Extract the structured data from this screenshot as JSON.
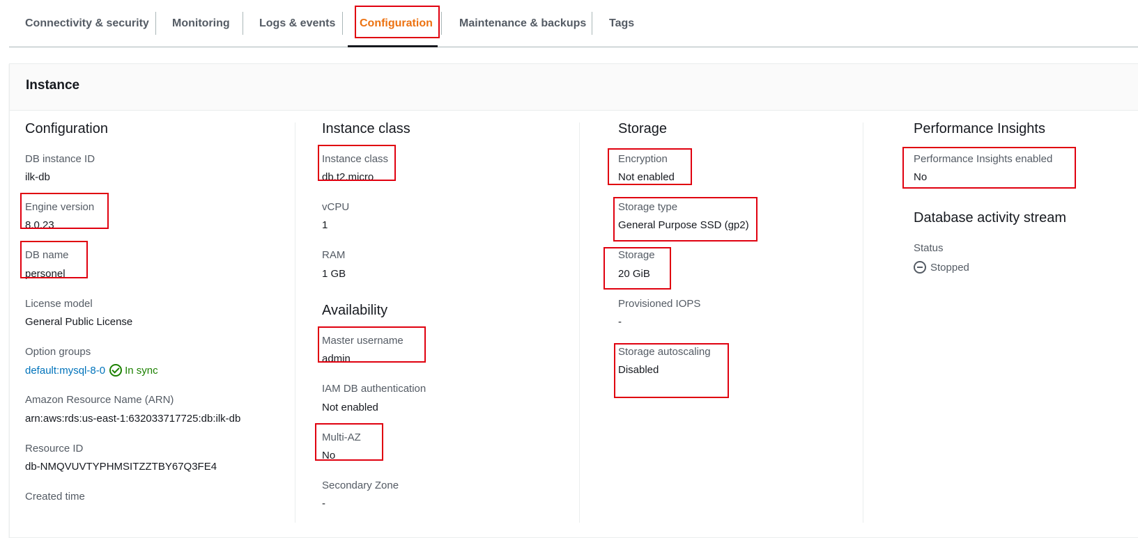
{
  "tabs": [
    {
      "label": "Connectivity & security"
    },
    {
      "label": "Monitoring"
    },
    {
      "label": "Logs & events"
    },
    {
      "label": "Configuration",
      "active": true
    },
    {
      "label": "Maintenance & backups"
    },
    {
      "label": "Tags"
    }
  ],
  "card": {
    "title": "Instance"
  },
  "configuration": {
    "title": "Configuration",
    "db_instance_id_label": "DB instance ID",
    "db_instance_id": "ilk-db",
    "engine_version_label": "Engine version",
    "engine_version": "8.0.23",
    "db_name_label": "DB name",
    "db_name": "personel",
    "license_model_label": "License model",
    "license_model": "General Public License",
    "option_groups_label": "Option groups",
    "option_group": "default:mysql-8-0",
    "option_group_status": "In sync",
    "arn_label": "Amazon Resource Name (ARN)",
    "arn": "arn:aws:rds:us-east-1:632033717725:db:ilk-db",
    "resource_id_label": "Resource ID",
    "resource_id": "db-NMQVUVTYPHMSITZZTBY67Q3FE4",
    "created_time_label": "Created time"
  },
  "instance_class": {
    "title": "Instance class",
    "instance_class_label": "Instance class",
    "instance_class": "db.t2.micro",
    "vcpu_label": "vCPU",
    "vcpu": "1",
    "ram_label": "RAM",
    "ram": "1 GB"
  },
  "availability": {
    "title": "Availability",
    "master_username_label": "Master username",
    "master_username": "admin",
    "iam_auth_label": "IAM DB authentication",
    "iam_auth": "Not enabled",
    "multi_az_label": "Multi-AZ",
    "multi_az": "No",
    "secondary_zone_label": "Secondary Zone",
    "secondary_zone": "-"
  },
  "storage": {
    "title": "Storage",
    "encryption_label": "Encryption",
    "encryption": "Not enabled",
    "storage_type_label": "Storage type",
    "storage_type": "General Purpose SSD (gp2)",
    "storage_label": "Storage",
    "storage": "20 GiB",
    "iops_label": "Provisioned IOPS",
    "iops": "-",
    "autoscaling_label": "Storage autoscaling",
    "autoscaling": "Disabled"
  },
  "performance": {
    "title": "Performance Insights",
    "enabled_label": "Performance Insights enabled",
    "enabled": "No"
  },
  "activity_stream": {
    "title": "Database activity stream",
    "status_label": "Status",
    "status": "Stopped"
  },
  "colors": {
    "active_tab": "#ec7211",
    "link": "#0073bb",
    "success": "#1d8102",
    "highlight": "#e0000f"
  }
}
